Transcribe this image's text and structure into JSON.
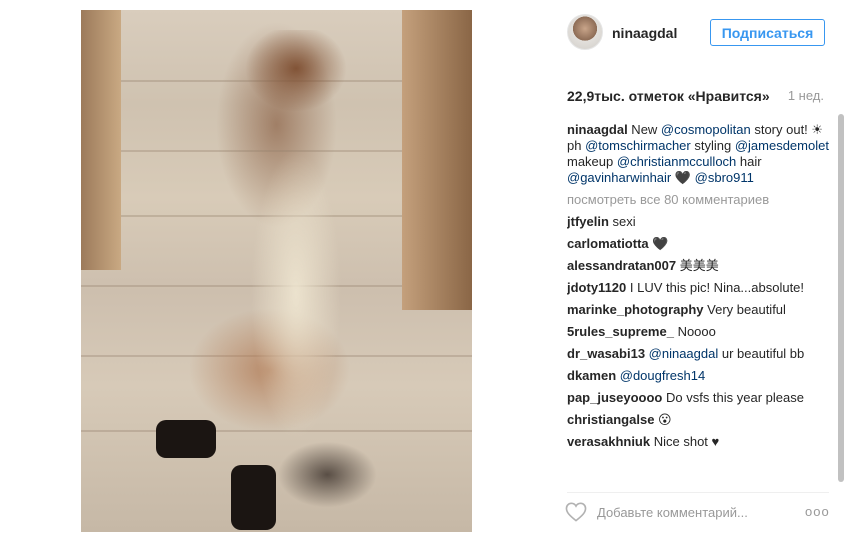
{
  "post": {
    "image_alt": "photo",
    "author": "ninaagdal",
    "follow_label": "Подписаться",
    "likes": "22,9тыс. отметок «Нравится»",
    "time_ago": "1 нед."
  },
  "caption": {
    "username": "ninaagdal",
    "t1": " New ",
    "m1": "@cosmopolitan",
    "t2": " story out! ☀ ph ",
    "m2": "@tomschirmacher",
    "t3": " styling ",
    "m3": "@jamesdemolet",
    "t4": " makeup ",
    "m4": "@christianmcculloch",
    "t5": " hair ",
    "m5": "@gavinharwinhair",
    "t6": " 🖤 ",
    "m6": "@sbro911"
  },
  "view_all": "посмотреть все 80 комментариев",
  "comments": [
    {
      "user": "jtfyelin",
      "text": " sexi"
    },
    {
      "user": "carlomatiotta",
      "text": " 🖤"
    },
    {
      "user": "alessandratan007",
      "text": " 美美美"
    },
    {
      "user": "jdoty1120",
      "text": " I LUV this pic! Nina...absolute!"
    },
    {
      "user": "marinke_photography",
      "text": " Very beautiful"
    },
    {
      "user": "5rules_supreme_",
      "text": " Noooo"
    },
    {
      "user": "dr_wasabi13",
      "mention": " @ninaagdal",
      "text": " ur beautiful bb"
    },
    {
      "user": "dkamen",
      "mention": " @dougfresh14",
      "text": ""
    },
    {
      "user": "pap_juseyoooo",
      "text": " Do vsfs this year please"
    },
    {
      "user": "christiangalse",
      "text": " 😮"
    },
    {
      "user": "verasakhniuk",
      "text": " Nice shot ♥"
    }
  ],
  "footer": {
    "heart_icon": "heart-outline-icon",
    "placeholder": "Добавьте комментарий...",
    "more": "ооо"
  }
}
